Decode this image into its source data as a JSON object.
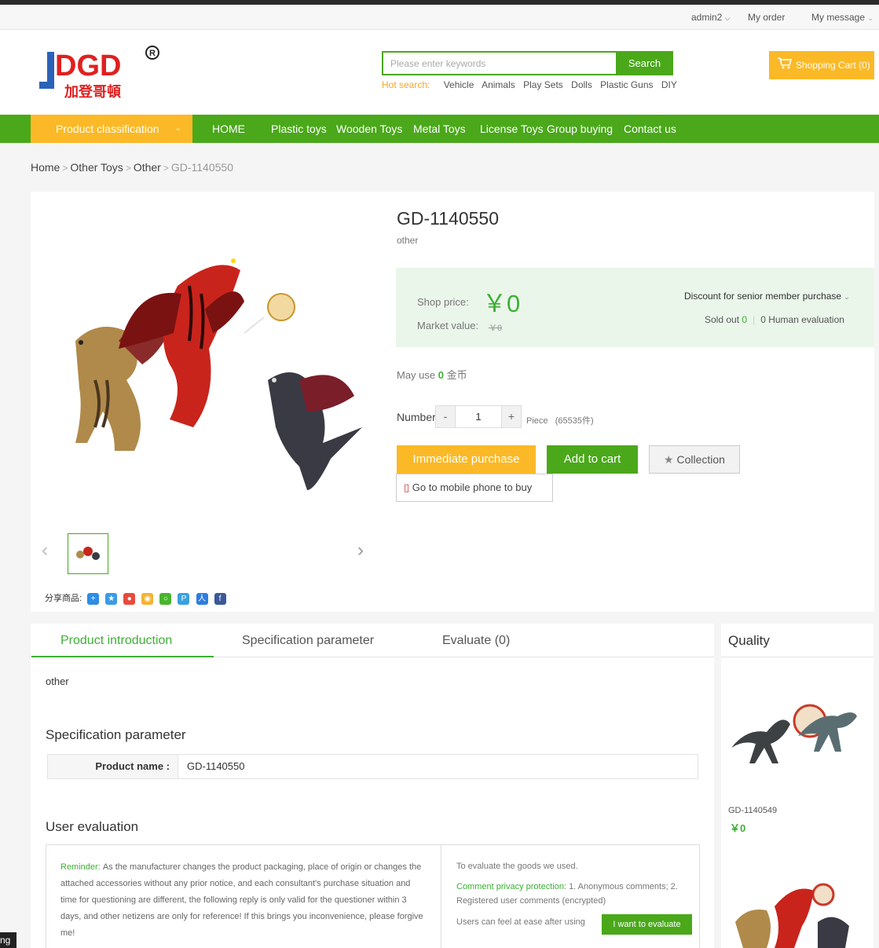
{
  "topnav": {
    "user": "admin2",
    "order": "My order",
    "message": "My message"
  },
  "header": {
    "logo_text": "JDGD",
    "logo_cn": "加登哥頓",
    "search_placeholder": "Please enter keywords",
    "search_button": "Search",
    "hot_label": "Hot search:",
    "hot_keywords": [
      "Vehicle",
      "Animals",
      "Play Sets",
      "Dolls",
      "Plastic Guns",
      "DIY"
    ],
    "cart": "Shopping Cart (0)"
  },
  "nav": {
    "category": "Product classification",
    "links": [
      "HOME",
      "Plastic toys",
      "Wooden Toys",
      "Metal Toys",
      "License Toys",
      "Group buying",
      "Contact us"
    ]
  },
  "breadcrumb": [
    "Home",
    "Other Toys",
    "Other",
    "GD-1140550"
  ],
  "share": {
    "label": "分享商品:"
  },
  "product": {
    "title": "GD-1140550",
    "subtitle": "other",
    "shop_price_label": "Shop price:",
    "shop_price": "￥0",
    "market_label": "Market value:",
    "market_value": "￥0",
    "discount": "Discount for senior member purchase",
    "sold_label": "Sold out",
    "sold_count": "0",
    "evaluation": "0 Human evaluation",
    "may_use_label": "May use",
    "may_use_value": "0",
    "may_use_unit": "金币",
    "number_label": "Number",
    "quantity": "1",
    "unit": "Piece",
    "stock": "(65535件)",
    "buy_button": "Immediate purchase",
    "cart_button": "Add to cart",
    "collection_button": "Collection",
    "mobile_button": "Go to mobile phone to buy"
  },
  "tabs": [
    "Product introduction",
    "Specification parameter",
    "Evaluate (0)"
  ],
  "content": {
    "intro": "other",
    "spec_heading": "Specification parameter",
    "spec_key": "Product name :",
    "spec_value": "GD-1140550",
    "eval_heading": "User evaluation",
    "reminder_label": "Reminder:",
    "reminder_text": "As the manufacturer changes the product packaging, place of origin or changes the attached accessories without any prior notice, and each consultant's purchase situation and time for questioning are different, the following reply is only valid for the questioner within 3 days, and other netizens are only for reference! If this brings you inconvenience, please forgive me!",
    "eval_intro": "To evaluate the goods we used.",
    "privacy_label": "Comment privacy protection:",
    "privacy_text": "1. Anonymous comments; 2. Registered user comments (encrypted)",
    "ease_text": "Users can feel at ease after using",
    "eval_button": "I want to evaluate"
  },
  "sidebar": {
    "heading": "Quality",
    "items": [
      {
        "name": "GD-1140549",
        "price": "￥0"
      }
    ]
  },
  "floating_tab": "ng",
  "colors": {
    "green": "#4aa81a",
    "price_green": "#3cb034",
    "orange": "#fbb927"
  }
}
